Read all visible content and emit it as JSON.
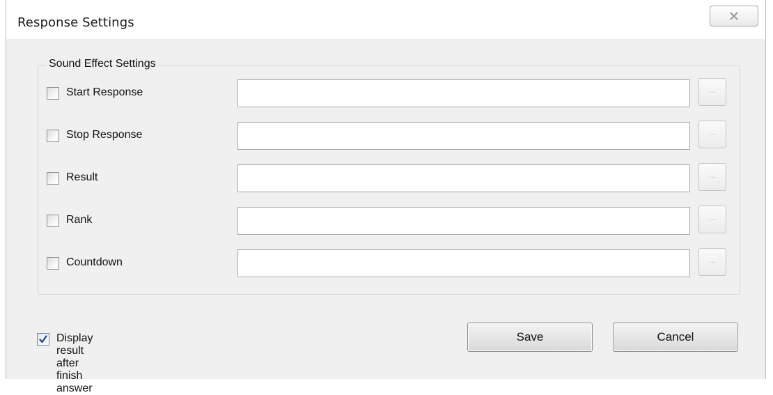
{
  "window": {
    "title": "Response Settings",
    "close_icon": "close-icon"
  },
  "sound_group": {
    "legend": "Sound Effect Settings",
    "rows": [
      {
        "label": "Start Response",
        "checked": false,
        "value": "",
        "browse_label": "..."
      },
      {
        "label": "Stop Response",
        "checked": false,
        "value": "",
        "browse_label": "..."
      },
      {
        "label": "Result",
        "checked": false,
        "value": "",
        "browse_label": "..."
      },
      {
        "label": "Rank",
        "checked": false,
        "value": "",
        "browse_label": "..."
      },
      {
        "label": "Countdown",
        "checked": false,
        "value": "",
        "browse_label": "..."
      }
    ]
  },
  "display_result": {
    "label": "Display result after finish answer",
    "checked": true
  },
  "buttons": {
    "save": "Save",
    "cancel": "Cancel"
  },
  "colors": {
    "dialog_bg": "#f0f0f0",
    "titlebar_bg": "#ffffff",
    "check_mark": "#1f3f8f"
  }
}
